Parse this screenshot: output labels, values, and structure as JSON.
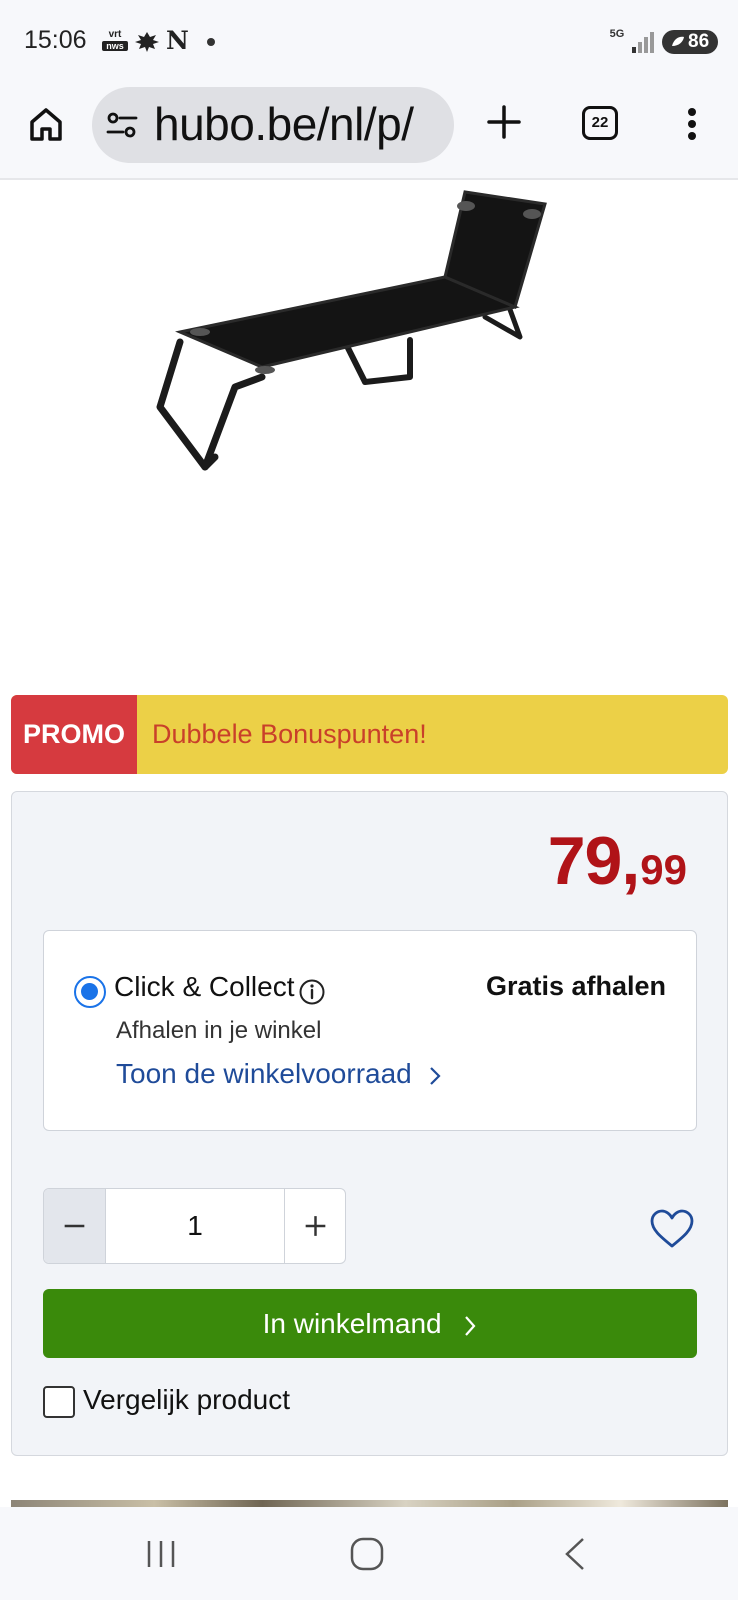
{
  "status_bar": {
    "time": "15:06",
    "vrt_top": "vrt",
    "vrt_bottom": "nws",
    "n_label": "N",
    "network": "5G",
    "battery": "86",
    "icons": [
      "vrt-nws-icon",
      "leaf-icon",
      "n-icon",
      "dot-icon",
      "signal-icon",
      "battery-icon"
    ]
  },
  "browser": {
    "url": "hubo.be/nl/p/",
    "tab_count": "22",
    "icons": [
      "home-icon",
      "tune-icon",
      "plus-icon",
      "tabs-icon",
      "more-vert-icon"
    ]
  },
  "product": {
    "image_icon": "sun-lounger-image"
  },
  "promo": {
    "tag": "PROMO",
    "text": "Dubbele Bonuspunten!"
  },
  "price": {
    "integer": "79",
    "comma": ",",
    "decimals": "99",
    "color": "#b01318"
  },
  "delivery": {
    "option_label": "Click & Collect",
    "option_selected": true,
    "cost_label": "Gratis afhalen",
    "subtitle": "Afhalen in je winkel",
    "stock_link": "Toon de winkelvoorraad"
  },
  "quantity": {
    "value": "1"
  },
  "cart": {
    "button_label": "In winkelmand",
    "color": "#3a8a0b"
  },
  "compare": {
    "label": "Vergelijk product",
    "checked": false
  },
  "nav_bar": {
    "icons": [
      "recents-icon",
      "home-icon",
      "back-icon"
    ]
  }
}
